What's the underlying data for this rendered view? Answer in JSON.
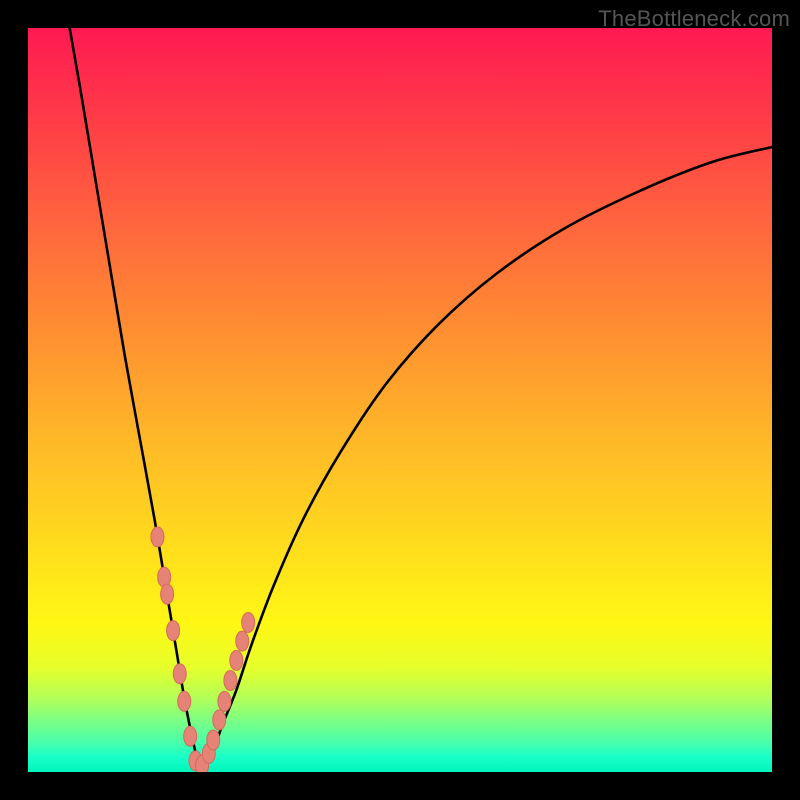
{
  "watermark": "TheBottleneck.com",
  "colors": {
    "frame_bg": "#000000",
    "gradient_top": "#ff1a52",
    "gradient_bottom": "#00f5bd",
    "curve": "#000000",
    "marker_fill": "#e58377",
    "marker_stroke": "#d46a5c"
  },
  "chart_data": {
    "type": "line",
    "title": "",
    "xlabel": "",
    "ylabel": "",
    "xlim": [
      0,
      100
    ],
    "ylim": [
      0,
      100
    ],
    "grid": false,
    "note": "V-shaped curve; minimum near x≈23, y≈0. y values are approximate, read from pixels.",
    "series": [
      {
        "name": "curve",
        "x": [
          5.6,
          7,
          9,
          11,
          13,
          15,
          17,
          19,
          20,
          21,
          22,
          23,
          24,
          25,
          26,
          28,
          30,
          33,
          37,
          42,
          48,
          55,
          63,
          72,
          82,
          92,
          100
        ],
        "y": [
          100,
          92,
          80,
          68,
          56,
          45,
          34,
          22,
          16,
          10,
          5,
          1,
          1,
          3,
          6,
          11,
          17,
          25,
          34,
          43,
          52,
          60,
          67,
          73,
          78,
          82,
          84
        ]
      }
    ],
    "markers": {
      "name": "highlight-points",
      "x": [
        17.4,
        18.3,
        18.7,
        19.5,
        20.4,
        21.0,
        21.8,
        22.5,
        23.4,
        24.3,
        24.9,
        25.7,
        26.4,
        27.2,
        28.0,
        28.8,
        29.6
      ],
      "y": [
        31.6,
        26.2,
        23.9,
        19.0,
        13.2,
        9.5,
        4.8,
        1.5,
        0.9,
        2.5,
        4.3,
        7.0,
        9.5,
        12.3,
        15.0,
        17.6,
        20.1
      ],
      "rx": 6.5,
      "ry": 10
    }
  }
}
